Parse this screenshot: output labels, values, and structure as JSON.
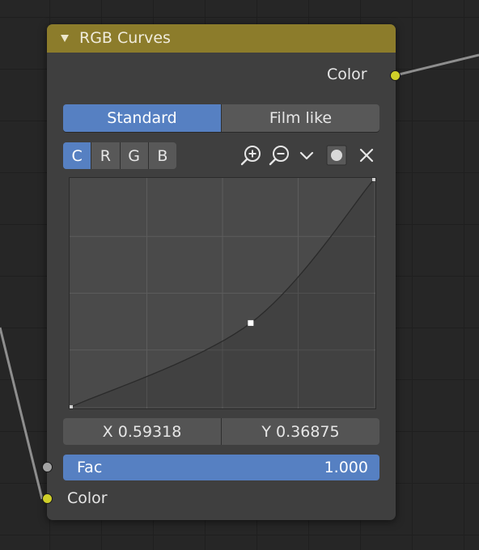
{
  "node": {
    "title": "RGB Curves",
    "output_label": "Color",
    "mode_tabs": [
      "Standard",
      "Film like"
    ],
    "active_mode": "Standard",
    "channels": [
      "C",
      "R",
      "G",
      "B"
    ],
    "active_channel": "C",
    "tools": [
      "zoom-in-icon",
      "zoom-out-icon",
      "chevron-down-icon",
      "clipping-toggle-icon",
      "close-icon"
    ],
    "coord_x": "X 0.59318",
    "coord_y": "Y 0.36875",
    "fac_label": "Fac",
    "fac_value": "1.000",
    "input_label": "Color"
  },
  "curve": {
    "points": [
      [
        0,
        0
      ],
      [
        0.59318,
        0.36875
      ],
      [
        1,
        1
      ]
    ],
    "selected_point": [
      0.59318,
      0.36875
    ],
    "range": [
      0,
      1
    ],
    "grid_divisions": 4
  },
  "colors": {
    "header": "#8c7c2b",
    "node_body": "#3f3f3f",
    "accent": "#5680c2",
    "socket_color": "#cfcf29",
    "socket_float": "#a3a3a3"
  }
}
